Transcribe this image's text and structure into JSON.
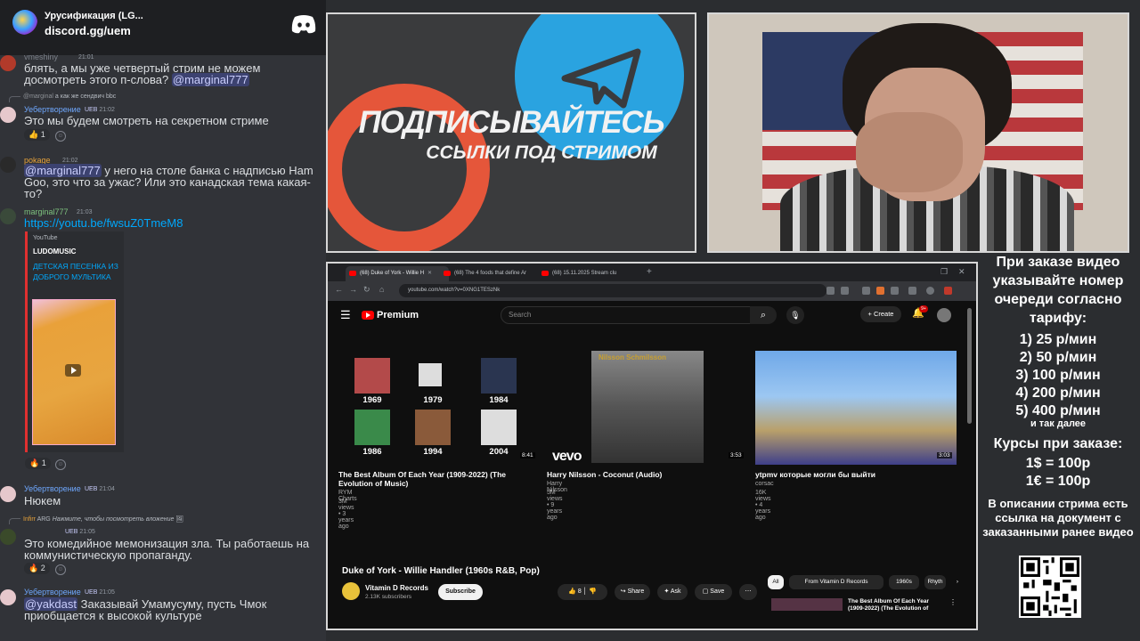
{
  "server": {
    "title": "Урусификация (LG...",
    "link": "discord.gg/uem"
  },
  "messages": {
    "m1": {
      "user": "vmeshiny",
      "time": "21:01",
      "text": "блять, а мы уже четвертый стрим не можем досмотреть этого п-слова? ",
      "mention": "@marginal777"
    },
    "m2": {
      "reply_user": "@marginal",
      "reply_text": "а как же сендвич bbc",
      "user": "Уебертворение",
      "badge": "UEB",
      "time": "21:02",
      "text": "Это мы будем смотреть на секретном стриме",
      "reaction_count": "1"
    },
    "m3": {
      "user": "pokage",
      "time": "21:02",
      "mention": "@marginal777",
      "text": " у него на столе банка с надписью Ham Goo, это что за ужас? Или это канадская тема какая-то?"
    },
    "m4": {
      "user": "marginal777",
      "time": "21:03",
      "link": "https://youtu.be/fwsuZ0TmeM8"
    },
    "embed": {
      "provider": "YouTube",
      "author": "LUDOMUSIC",
      "title": "ДЕТСКАЯ ПЕСЕНКА ИЗ ДОБРОГО МУЛЬТИКА",
      "reaction_count": "1"
    },
    "m5": {
      "user": "Уебертворение",
      "badge": "UEB",
      "time": "21:04",
      "text": "Нюкем"
    },
    "m6": {
      "reply_user": "Infirr",
      "reply_badge": "ARG",
      "reply_text": "Нажмите, чтобы посмотреть вложение",
      "badge": "UEB",
      "time": "21:05",
      "text": "Это комедийное мемонизация зла. Ты работаешь на коммунистическую пропаганду.",
      "reaction_count": "2"
    },
    "m7": {
      "user": "Уебертворение",
      "badge": "UEB",
      "time": "21:05",
      "mention": "@yakdast",
      "text": " Заказывай Умамусуму, пусть Чмок приобщается к высокой культуре"
    }
  },
  "promo": {
    "title": "ПОДПИСЫВАЙТЕСЬ",
    "subtitle": "ССЫЛКИ ПОД СТРИМОМ"
  },
  "browser": {
    "tabs": [
      "(68) Duke of York - Willie H",
      "(68) The 4 foods that define Ar",
      "(68) 15.11.2025 Stream clu"
    ],
    "url": "youtube.com/watch?v=0XNG1TESzNk",
    "yt": {
      "brand": "Premium",
      "search_placeholder": "Search",
      "create": "Create",
      "bell_badge": "9+",
      "cards": [
        {
          "title": "The Best Album Of Each Year (1909-2022) (The Evolution of Music)",
          "channel": "RYM Charts",
          "stats": "3M views • 3 years ago",
          "duration": "8:41",
          "years": [
            "1969",
            "1979",
            "1984",
            "1986",
            "1994",
            "2004"
          ]
        },
        {
          "title": "Harry Nilsson - Coconut (Audio)",
          "channel": "Harry Nilsson",
          "stats": "5M views • 9 years ago",
          "duration": "3:53",
          "brand": "vevo",
          "art_text": "Nilsson Schmilsson"
        },
        {
          "title": "ytpmv которые могли бы выйти",
          "channel": "corsac",
          "stats": "16K views • 4 years ago",
          "duration": "3:03"
        }
      ],
      "video_title": "Duke of York - Willie Handler (1960s R&B, Pop)",
      "channel_name": "Vitamin D Records",
      "channel_subs": "2.13K subscribers",
      "subscribe": "Subscribe",
      "likes": "8",
      "share": "Share",
      "ask": "Ask",
      "save": "Save",
      "chips": [
        "All",
        "From Vitamin D Records",
        "1960s",
        "Rhyth"
      ],
      "rec_title": "The Best Album Of Each Year (1909-2022) (The Evolution of"
    }
  },
  "info": {
    "intro": "При заказе видео указывайте номер очереди согласно тарифу:",
    "rates": [
      "1) 25 р/мин",
      "2) 50 р/мин",
      "3) 100 р/мин",
      "4) 200 р/мин",
      "5) 400 р/мин"
    ],
    "etc": "и так далее",
    "courses_title": "Курсы при заказе:",
    "courses": [
      "1$ = 100р",
      "1€ = 100р"
    ],
    "doc": "В описании стрима есть ссылка на документ с заказанными ранее видео"
  }
}
